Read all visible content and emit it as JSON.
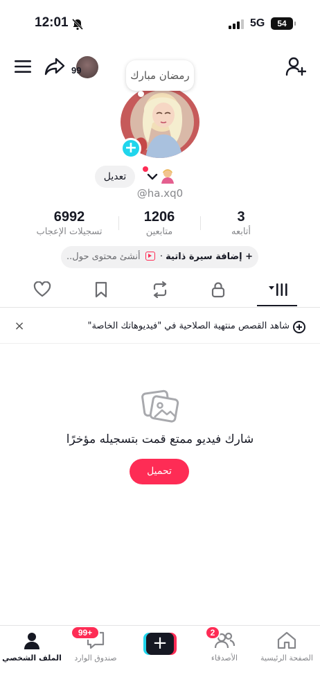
{
  "status_bar": {
    "time": "12:01",
    "network": "5G",
    "battery": "54"
  },
  "header": {
    "mini_avatar_count": "99"
  },
  "profile": {
    "note": "رمضان مبارك",
    "edit_label": "تعديل",
    "username": "@ha.xq0",
    "stats": {
      "likes_value": "6992",
      "likes_label": "تسجيلات الإعجاب",
      "followers_value": "1206",
      "followers_label": "متابعين",
      "following_value": "3",
      "following_label": "أتابعه"
    },
    "bio_add": "+ إضافة سيرة ذاتية",
    "bio_separator": "·",
    "bio_create": "أنشئ محتوى حول..",
    "accent": "#fe2c55",
    "accent_secondary": "#20d5ec"
  },
  "tabs": [
    "videos-grid",
    "private-lock",
    "reposts",
    "saved-bookmark",
    "liked-heart"
  ],
  "banner": {
    "text": "شاهد القصص منتهية الصلاحية في \"فيديوهاتك الخاصة\"",
    "close": "×"
  },
  "empty_state": {
    "message": "شارك فيديو ممتع قمت بتسجيله مؤخرًا",
    "upload_label": "تحميل"
  },
  "bottom_nav": {
    "home": "الصفحة الرئيسية",
    "friends": "الأصدقاء",
    "friends_badge": "2",
    "create": "+",
    "inbox": "صندوق الوارد",
    "inbox_badge": "99+",
    "profile": "الملف الشخصي"
  }
}
